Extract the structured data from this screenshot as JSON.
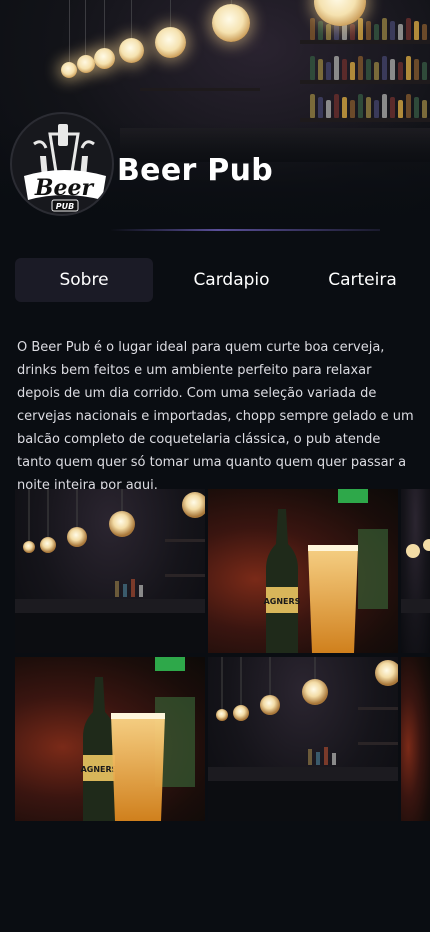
{
  "venue": {
    "name": "Beer Pub",
    "logo_text": "Beer",
    "logo_subtext": "PUB"
  },
  "tabs": [
    {
      "label": "Sobre",
      "active": true
    },
    {
      "label": "Cardapio",
      "active": false
    },
    {
      "label": "Carteira",
      "active": false
    }
  ],
  "about": {
    "text": "O Beer Pub é o lugar ideal para quem curte boa cerveja, drinks bem feitos e um ambiente perfeito para relaxar depois de um dia corrido. Com uma seleção variada de cervejas nacionais e importadas, chopp sempre gelado e um balcão completo de coquetelaria clássica, o pub atende tanto quem quer só tomar uma quanto quem quer passar a noite inteira por aqui."
  },
  "gallery": {
    "photos": [
      {
        "subject": "bar-interior-icon"
      },
      {
        "subject": "beer-bottle-glass-icon",
        "label": "AGNERS"
      },
      {
        "subject": "beer-bottle-glass-icon",
        "label": "AGNERS"
      },
      {
        "subject": "bar-interior-icon"
      }
    ]
  },
  "colors": {
    "background": "#0a0d12",
    "tab_active": "#1b1b26",
    "divider_accent": "#5a4f99"
  }
}
